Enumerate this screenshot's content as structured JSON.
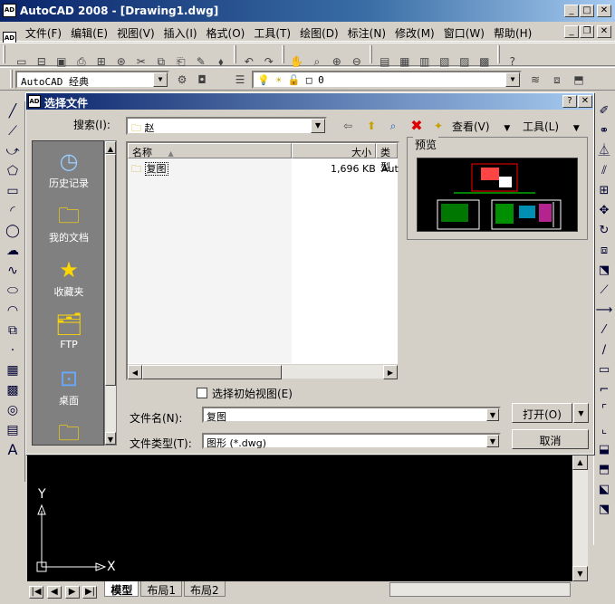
{
  "window": {
    "title": "AutoCAD 2008 - [Drawing1.dwg]",
    "app_icon": "AD"
  },
  "menu": [
    "文件(F)",
    "编辑(E)",
    "视图(V)",
    "插入(I)",
    "格式(O)",
    "工具(T)",
    "绘图(D)",
    "标注(N)",
    "修改(M)",
    "窗口(W)",
    "帮助(H)"
  ],
  "workspace": {
    "value": "AutoCAD 经典"
  },
  "layer": {
    "value": "0"
  },
  "dialog": {
    "title": "选择文件",
    "search_label": "搜索(I):",
    "folder": "赵",
    "view_label": "查看(V)",
    "tools_label": "工具(L)",
    "places": [
      {
        "label": "历史记录",
        "icon": "history-icon",
        "glyph": "◷"
      },
      {
        "label": "我的文档",
        "icon": "documents-icon",
        "glyph": "📁"
      },
      {
        "label": "收藏夹",
        "icon": "favorites-icon",
        "glyph": "★"
      },
      {
        "label": "FTP",
        "icon": "ftp-icon",
        "glyph": "🗂"
      },
      {
        "label": "桌面",
        "icon": "desktop-icon",
        "glyph": "⊡"
      },
      {
        "label": "",
        "icon": "folder-icon",
        "glyph": "📂"
      }
    ],
    "columns": {
      "name": "名称",
      "size": "大小",
      "type": "类型"
    },
    "files": [
      {
        "name": "复图",
        "size": "1,696 KB",
        "type": "Aut"
      }
    ],
    "preview_label": "预览",
    "initial_view_label": "选择初始视图(E)",
    "filename_label": "文件名(N):",
    "filename_value": "复图",
    "filetype_label": "文件类型(T):",
    "filetype_value": "图形 (*.dwg)",
    "open_label": "打开(O)",
    "cancel_label": "取消"
  },
  "axes": {
    "y": "Y",
    "x": "X"
  },
  "tabs": [
    "模型",
    "布局1",
    "布局2"
  ]
}
